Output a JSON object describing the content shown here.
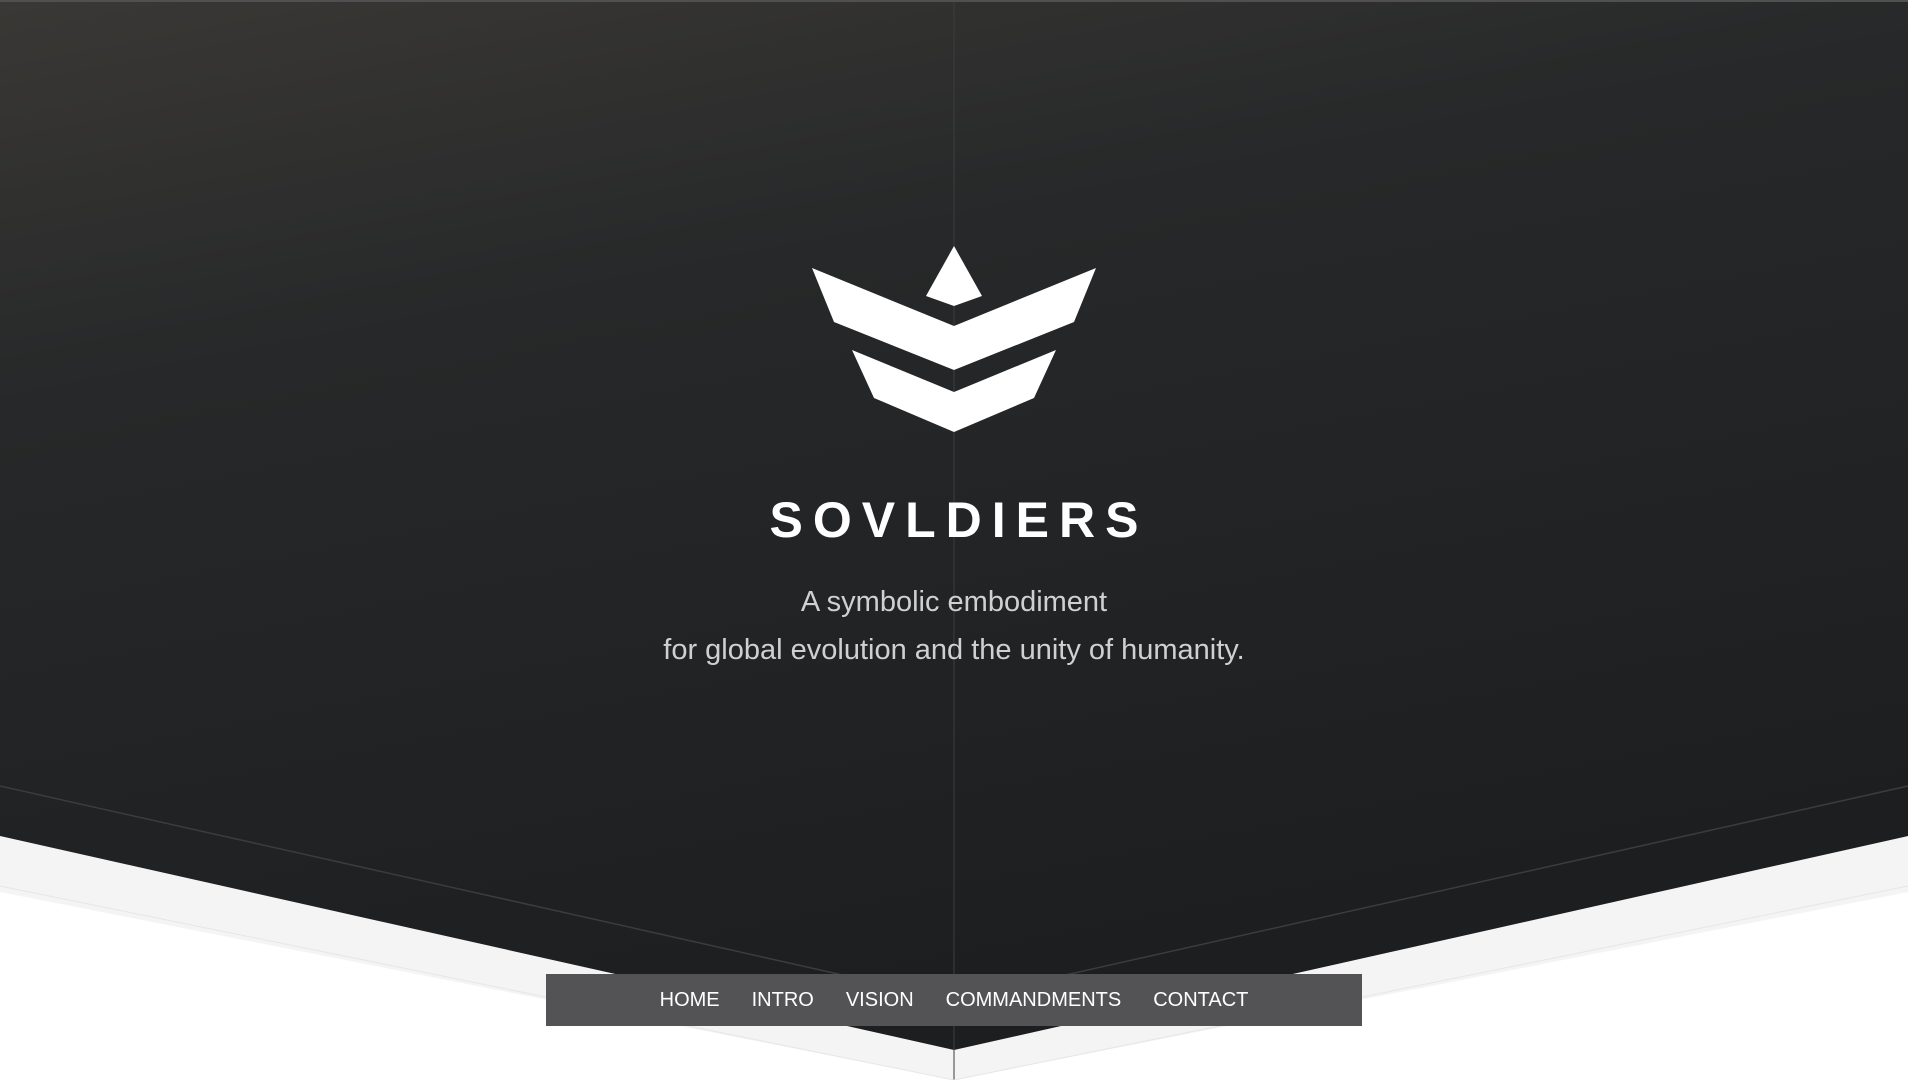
{
  "hero": {
    "title": "SOVLDIERS",
    "tagline_line1": "A symbolic embodiment",
    "tagline_line2": "for global evolution and the unity of humanity.",
    "logo_icon": "crown-chevron-logo"
  },
  "nav": {
    "items": [
      {
        "label": "HOME"
      },
      {
        "label": "INTRO"
      },
      {
        "label": "VISION"
      },
      {
        "label": "COMMANDMENTS"
      },
      {
        "label": "CONTACT"
      }
    ]
  },
  "colors": {
    "hero_dark": "#1e2022",
    "hero_top": "#33322f",
    "nav_bg": "#535355",
    "text": "#ffffff",
    "tagline": "#cfd0d2"
  }
}
